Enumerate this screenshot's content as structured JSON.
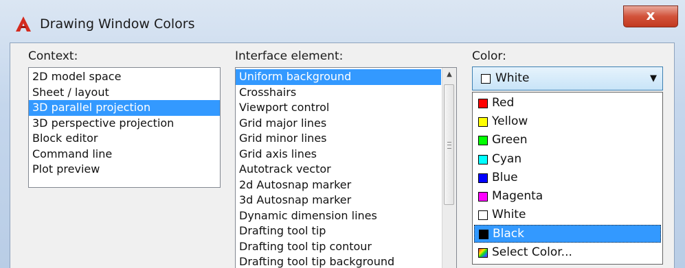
{
  "window": {
    "title": "Drawing Window Colors",
    "close_glyph": "x",
    "app_icon": "autocad-a-icon"
  },
  "context": {
    "label": "Context:",
    "items": [
      "2D model space",
      "Sheet / layout",
      "3D parallel projection",
      "3D perspective projection",
      "Block editor",
      "Command line",
      "Plot preview"
    ],
    "selected_index": 2
  },
  "interface_element": {
    "label": "Interface element:",
    "items": [
      "Uniform background",
      "Crosshairs",
      "Viewport control",
      "Grid major lines",
      "Grid minor lines",
      "Grid axis lines",
      "Autotrack vector",
      "2d Autosnap marker",
      "3d Autosnap marker",
      "Dynamic dimension lines",
      "Drafting tool tip",
      "Drafting tool tip contour",
      "Drafting tool tip background"
    ],
    "selected_index": 0
  },
  "color": {
    "label": "Color:",
    "selected": {
      "label": "White",
      "hex": "#ffffff"
    },
    "options": [
      {
        "label": "Red",
        "hex": "#ff0000"
      },
      {
        "label": "Yellow",
        "hex": "#ffff00"
      },
      {
        "label": "Green",
        "hex": "#00ff00"
      },
      {
        "label": "Cyan",
        "hex": "#00ffff"
      },
      {
        "label": "Blue",
        "hex": "#0000ff"
      },
      {
        "label": "Magenta",
        "hex": "#ff00ff"
      },
      {
        "label": "White",
        "hex": "#ffffff"
      },
      {
        "label": "Black",
        "hex": "#000000"
      },
      {
        "label": "Select Color...",
        "hex": "gradient"
      }
    ],
    "highlighted_index": 7
  },
  "colors": {
    "selection": "#3399ff",
    "close_button": "#c94a31"
  }
}
